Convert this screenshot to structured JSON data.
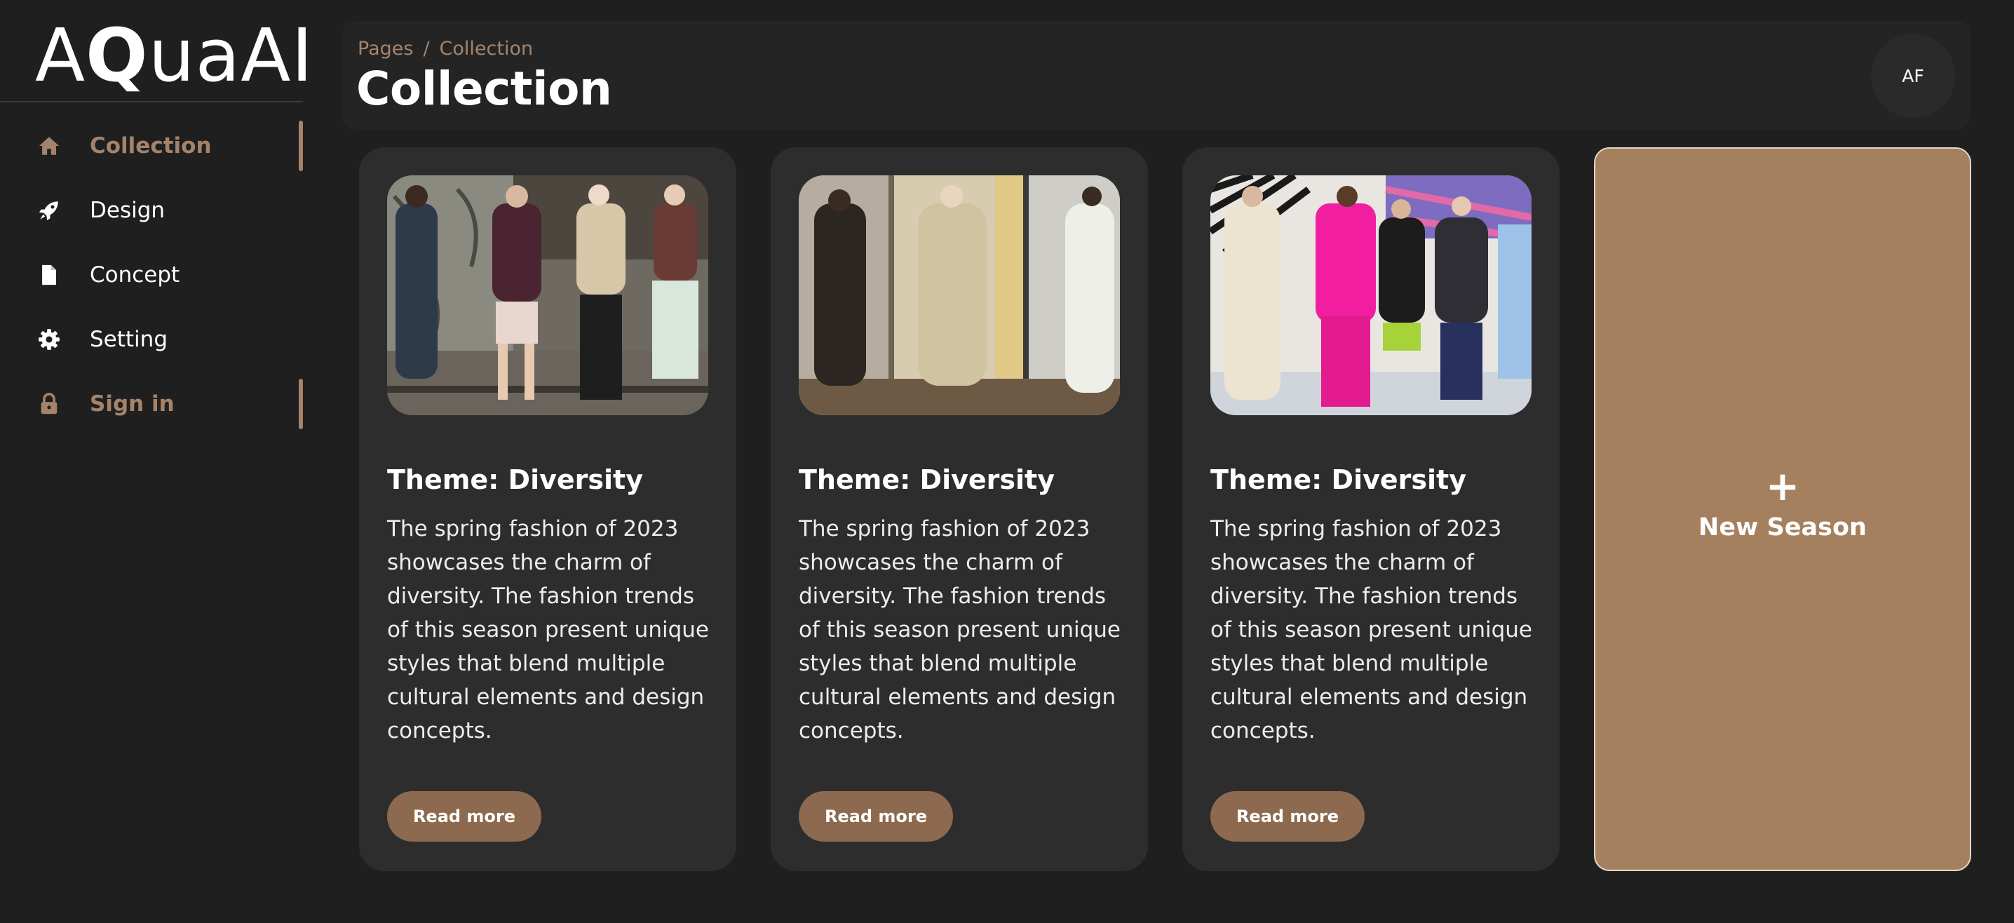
{
  "app": {
    "logo_prefix": "A",
    "logo_q": "Q",
    "logo_suffix": "uaAI"
  },
  "sidebar": {
    "items": [
      {
        "label": "Collection",
        "icon": "home-icon",
        "active": true
      },
      {
        "label": "Design",
        "icon": "rocket-icon",
        "active": false
      },
      {
        "label": "Concept",
        "icon": "document-icon",
        "active": false
      },
      {
        "label": "Setting",
        "icon": "gear-icon",
        "active": false
      },
      {
        "label": "Sign in",
        "icon": "lock-icon",
        "active": true
      }
    ]
  },
  "header": {
    "breadcrumb": [
      "Pages",
      "/",
      "Collection"
    ],
    "title": "Collection",
    "avatar_initials": "AF"
  },
  "cards": [
    {
      "title": "Theme: Diversity",
      "description": "The spring fashion of 2023 showcases the charm of diversity. The fashion trends of this season present unique styles that blend multiple cultural elements and design concepts.",
      "button": "Read more",
      "image": "runway-photo"
    },
    {
      "title": "Theme: Diversity",
      "description": "The spring fashion of 2023 showcases the charm of diversity. The fashion trends of this season present unique styles that blend multiple cultural elements and design concepts.",
      "button": "Read more",
      "image": "runway-photo"
    },
    {
      "title": "Theme: Diversity",
      "description": "The spring fashion of 2023 showcases the charm of diversity. The fashion trends of this season present unique styles that blend multiple cultural elements and design concepts.",
      "button": "Read more",
      "image": "runway-photo"
    }
  ],
  "new_season": {
    "icon": "+",
    "label": "New Season"
  },
  "colors": {
    "background": "#1f1f1f",
    "card": "#2d2d2d",
    "accent": "#a5836a",
    "button": "#8d6a4f",
    "new_season_bg": "#a5805f"
  }
}
